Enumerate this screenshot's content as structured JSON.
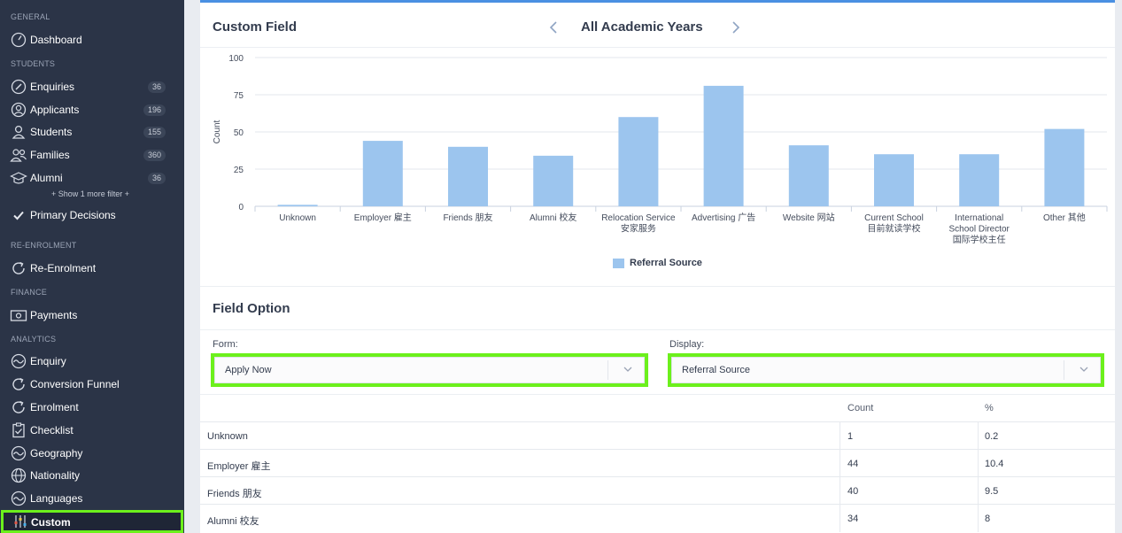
{
  "sidebar": {
    "sections": {
      "general": "GENERAL",
      "students": "STUDENTS",
      "reenrolment": "RE-ENROLMENT",
      "finance": "FINANCE",
      "analytics": "ANALYTICS"
    },
    "items": {
      "dashboard": {
        "label": "Dashboard",
        "icon": "dashboard-gauge-icon"
      },
      "enquiries": {
        "label": "Enquiries",
        "count": "36",
        "icon": "pencil-icon"
      },
      "applicants": {
        "label": "Applicants",
        "count": "196",
        "icon": "user-circle-icon"
      },
      "students": {
        "label": "Students",
        "count": "155",
        "icon": "user-icon"
      },
      "families": {
        "label": "Families",
        "count": "360",
        "icon": "users-icon"
      },
      "alumni": {
        "label": "Alumni",
        "count": "36",
        "icon": "graduation-cap-icon"
      },
      "show_filter": "+ Show 1 more filter +",
      "primary_decisions": {
        "label": "Primary Decisions",
        "icon": "check-icon"
      },
      "reenrolment": {
        "label": "Re-Enrolment",
        "icon": "refresh-icon"
      },
      "payments": {
        "label": "Payments",
        "icon": "money-icon"
      },
      "enquiry": {
        "label": "Enquiry",
        "icon": "chart-wave-icon"
      },
      "conversion_funnel": {
        "label": "Conversion Funnel",
        "icon": "refresh-icon"
      },
      "enrolment": {
        "label": "Enrolment",
        "icon": "refresh-icon"
      },
      "checklist": {
        "label": "Checklist",
        "icon": "clipboard-icon"
      },
      "geography": {
        "label": "Geography",
        "icon": "chart-wave-icon"
      },
      "nationality": {
        "label": "Nationality",
        "icon": "globe-icon"
      },
      "languages": {
        "label": "Languages",
        "icon": "chart-wave-icon"
      },
      "custom": {
        "label": "Custom",
        "icon": "sliders-icon"
      }
    }
  },
  "header": {
    "title": "Custom Field",
    "year": "All Academic Years",
    "prev_icon": "chevron-left-icon",
    "next_icon": "chevron-right-icon"
  },
  "chart_data": {
    "type": "bar",
    "categories": [
      [
        "Unknown"
      ],
      [
        "Employer 雇主"
      ],
      [
        "Friends 朋友"
      ],
      [
        "Alumni 校友"
      ],
      [
        "Relocation Service",
        "安家服务"
      ],
      [
        "Advertising 广告"
      ],
      [
        "Website 网站"
      ],
      [
        "Current School",
        "目前就读学校"
      ],
      [
        "International",
        "School Director",
        "国际学校主任"
      ],
      [
        "Other 其他"
      ]
    ],
    "series": [
      {
        "name": "Referral Source",
        "values": [
          1,
          44,
          40,
          34,
          60,
          81,
          41,
          35,
          35,
          52
        ]
      }
    ],
    "ylabel": "Count",
    "xlabel": "",
    "ylim": [
      0,
      100
    ],
    "yticks": [
      "0",
      "25",
      "50",
      "75",
      "100"
    ],
    "grid": true,
    "legend": "bottom-center",
    "bar_color": "#9cc5ee"
  },
  "field_option": {
    "title": "Field Option",
    "form_label": "Form:",
    "form_value": "Apply Now",
    "display_label": "Display:",
    "display_value": "Referral Source"
  },
  "table": {
    "headers": {
      "count": "Count",
      "percent": "%"
    },
    "rows": [
      {
        "name": "Unknown",
        "count": "1",
        "percent": "0.2"
      },
      {
        "name": "Employer 雇主",
        "count": "44",
        "percent": "10.4"
      },
      {
        "name": "Friends 朋友",
        "count": "40",
        "percent": "9.5"
      },
      {
        "name": "Alumni 校友",
        "count": "34",
        "percent": "8"
      }
    ]
  },
  "colors": {
    "sidebar_bg": "#2b3447",
    "accent": "#4a90e2",
    "highlight": "#6cf01c",
    "bar": "#9cc5ee"
  }
}
